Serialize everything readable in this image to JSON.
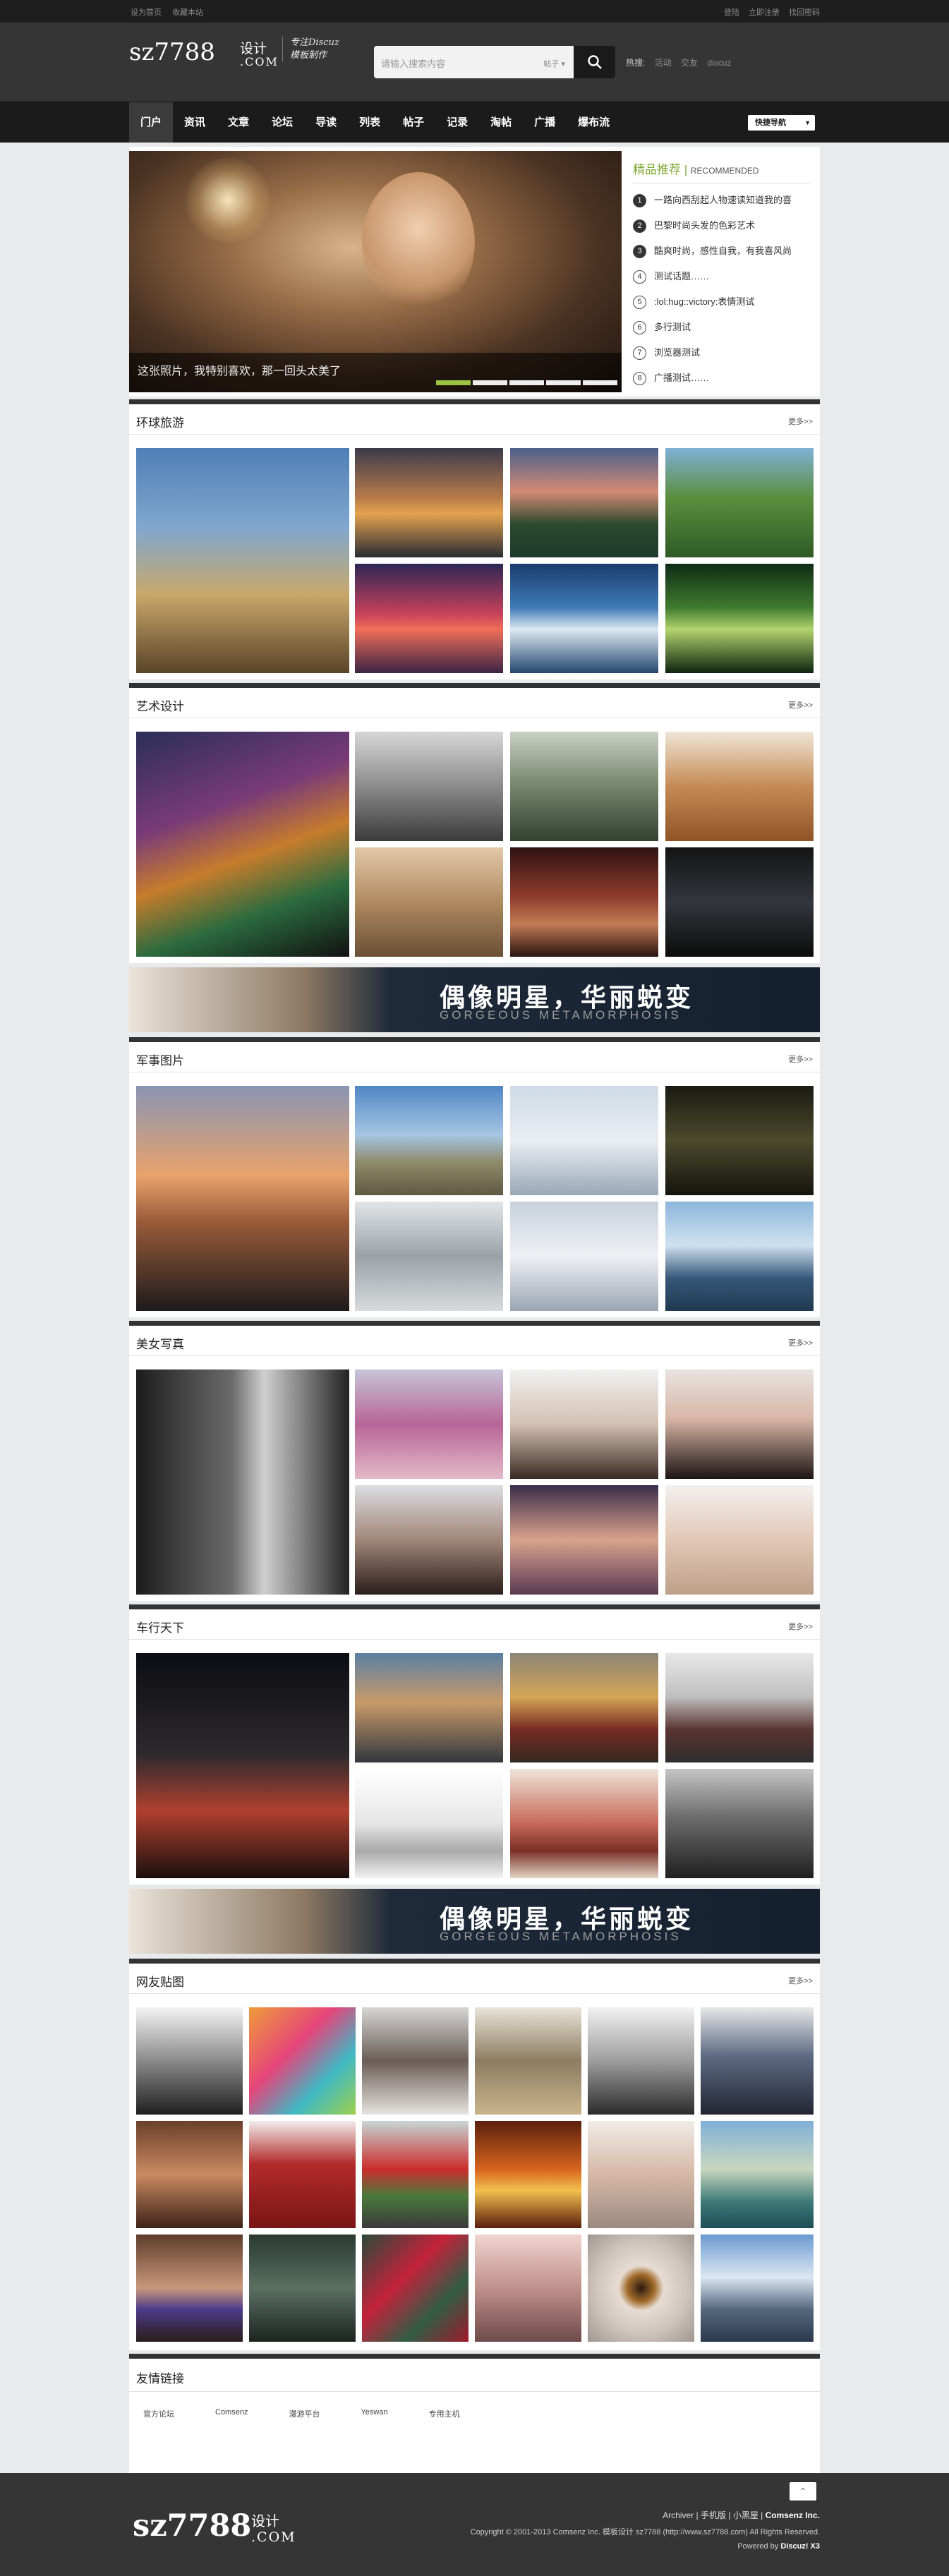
{
  "topbar": {
    "left": [
      "设为首页",
      "收藏本站"
    ],
    "right": [
      "登陆",
      "立即注册",
      "找回密码"
    ]
  },
  "header": {
    "logo": "sz7788",
    "logo_side": "设计",
    "logo_com": ".COM",
    "slogan_line1": "专注Discuz",
    "slogan_line2": "模板制作",
    "search_placeholder": "请输入搜索内容",
    "search_type": "帖子",
    "hot_label": "热搜:",
    "hot_words": [
      "活动",
      "交友",
      "discuz"
    ]
  },
  "nav": {
    "items": [
      "门户",
      "资讯",
      "文章",
      "论坛",
      "导读",
      "列表",
      "帖子",
      "记录",
      "淘帖",
      "广播",
      "爆布流"
    ],
    "active": "门户",
    "quick": "快捷导航"
  },
  "slider": {
    "caption": "这张照片，我特别喜欢，那一回头太美了"
  },
  "recommend": {
    "title": "精品推荐",
    "title_en": "RECOMMENDED",
    "items": [
      "一路向西刮起人物速读知道我的喜",
      "巴黎时尚头发的色彩艺术",
      "酷爽时尚，感性自我，有我喜风尚",
      "测试话题……",
      ":lol:hug::victory:表情测试",
      "多行测试",
      "浏览器测试",
      "广播测试……"
    ]
  },
  "sections": [
    {
      "title": "环球旅游",
      "more": "更多>>"
    },
    {
      "title": "艺术设计",
      "more": "更多>>"
    },
    {
      "title": "军事图片",
      "more": "更多>>"
    },
    {
      "title": "美女写真",
      "more": "更多>>"
    },
    {
      "title": "车行天下",
      "more": "更多>>"
    },
    {
      "title": "网友贴图",
      "more": "更多>>"
    }
  ],
  "banner": {
    "main": "偶像明星，华丽蜕变",
    "sub": "GORGEOUS METAMORPHOSIS"
  },
  "links": {
    "title": "友情链接",
    "items": [
      "官方论坛",
      "Comsenz",
      "漫游平台",
      "Yeswan",
      "专用主机"
    ]
  },
  "footer": {
    "logo": "sz7788",
    "logo_side": "设计",
    "logo_com": ".COM",
    "line1_parts": [
      "Archiver",
      "手机版",
      "小黑屋"
    ],
    "line1_brand": "Comsenz Inc.",
    "line2": "Copyright © 2001-2013 Comsenz Inc. 模板设计 sz7788 (http://www.sz7788.com) All Rights Reserved.",
    "line3_prefix": "Powered by",
    "line3_brand": "Discuz! X3"
  }
}
